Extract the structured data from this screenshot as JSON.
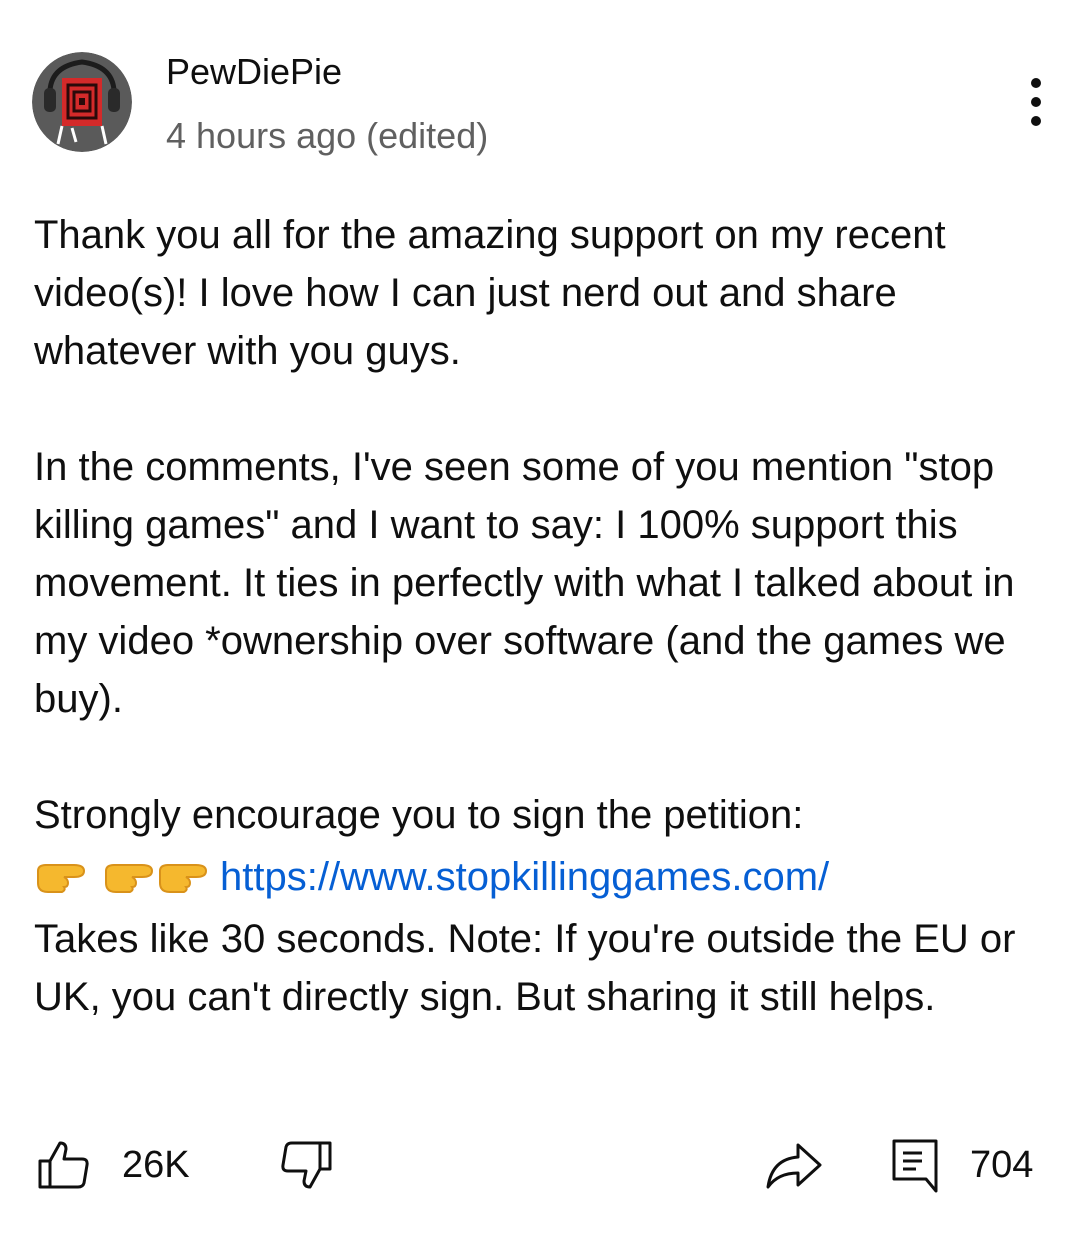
{
  "comment": {
    "author": "PewDiePie",
    "time": "4 hours ago (edited)",
    "paragraph1": "Thank you all for the amazing support on my recent video(s)! I love how I can just nerd out and share whatever with you guys.",
    "paragraph2": "In the comments, I've seen some of you mention \"stop killing games\" and I want to say: I 100% support this movement. It ties in perfectly with what I talked about in my video  *ownership over software (and the games we buy).",
    "paragraph3_line1": "Strongly encourage you to sign the petition:",
    "link": "https://www.stopkillinggames.com/",
    "paragraph3_rest": "Takes like 30 seconds. Note: If you're outside the EU or UK, you can't directly sign. But sharing it still helps."
  },
  "actions": {
    "like_count": "26K",
    "reply_count": "704"
  },
  "colors": {
    "link": "#065fd4",
    "secondary_text": "#606060",
    "pointer_emoji": "#f5b82e"
  },
  "icons": {
    "avatar": "avatar-image",
    "menu": "more-vertical-icon",
    "pointer": "backhand-index-pointing-right-emoji",
    "like": "thumb-up-icon",
    "dislike": "thumb-down-icon",
    "share": "share-icon",
    "reply": "comment-icon"
  }
}
